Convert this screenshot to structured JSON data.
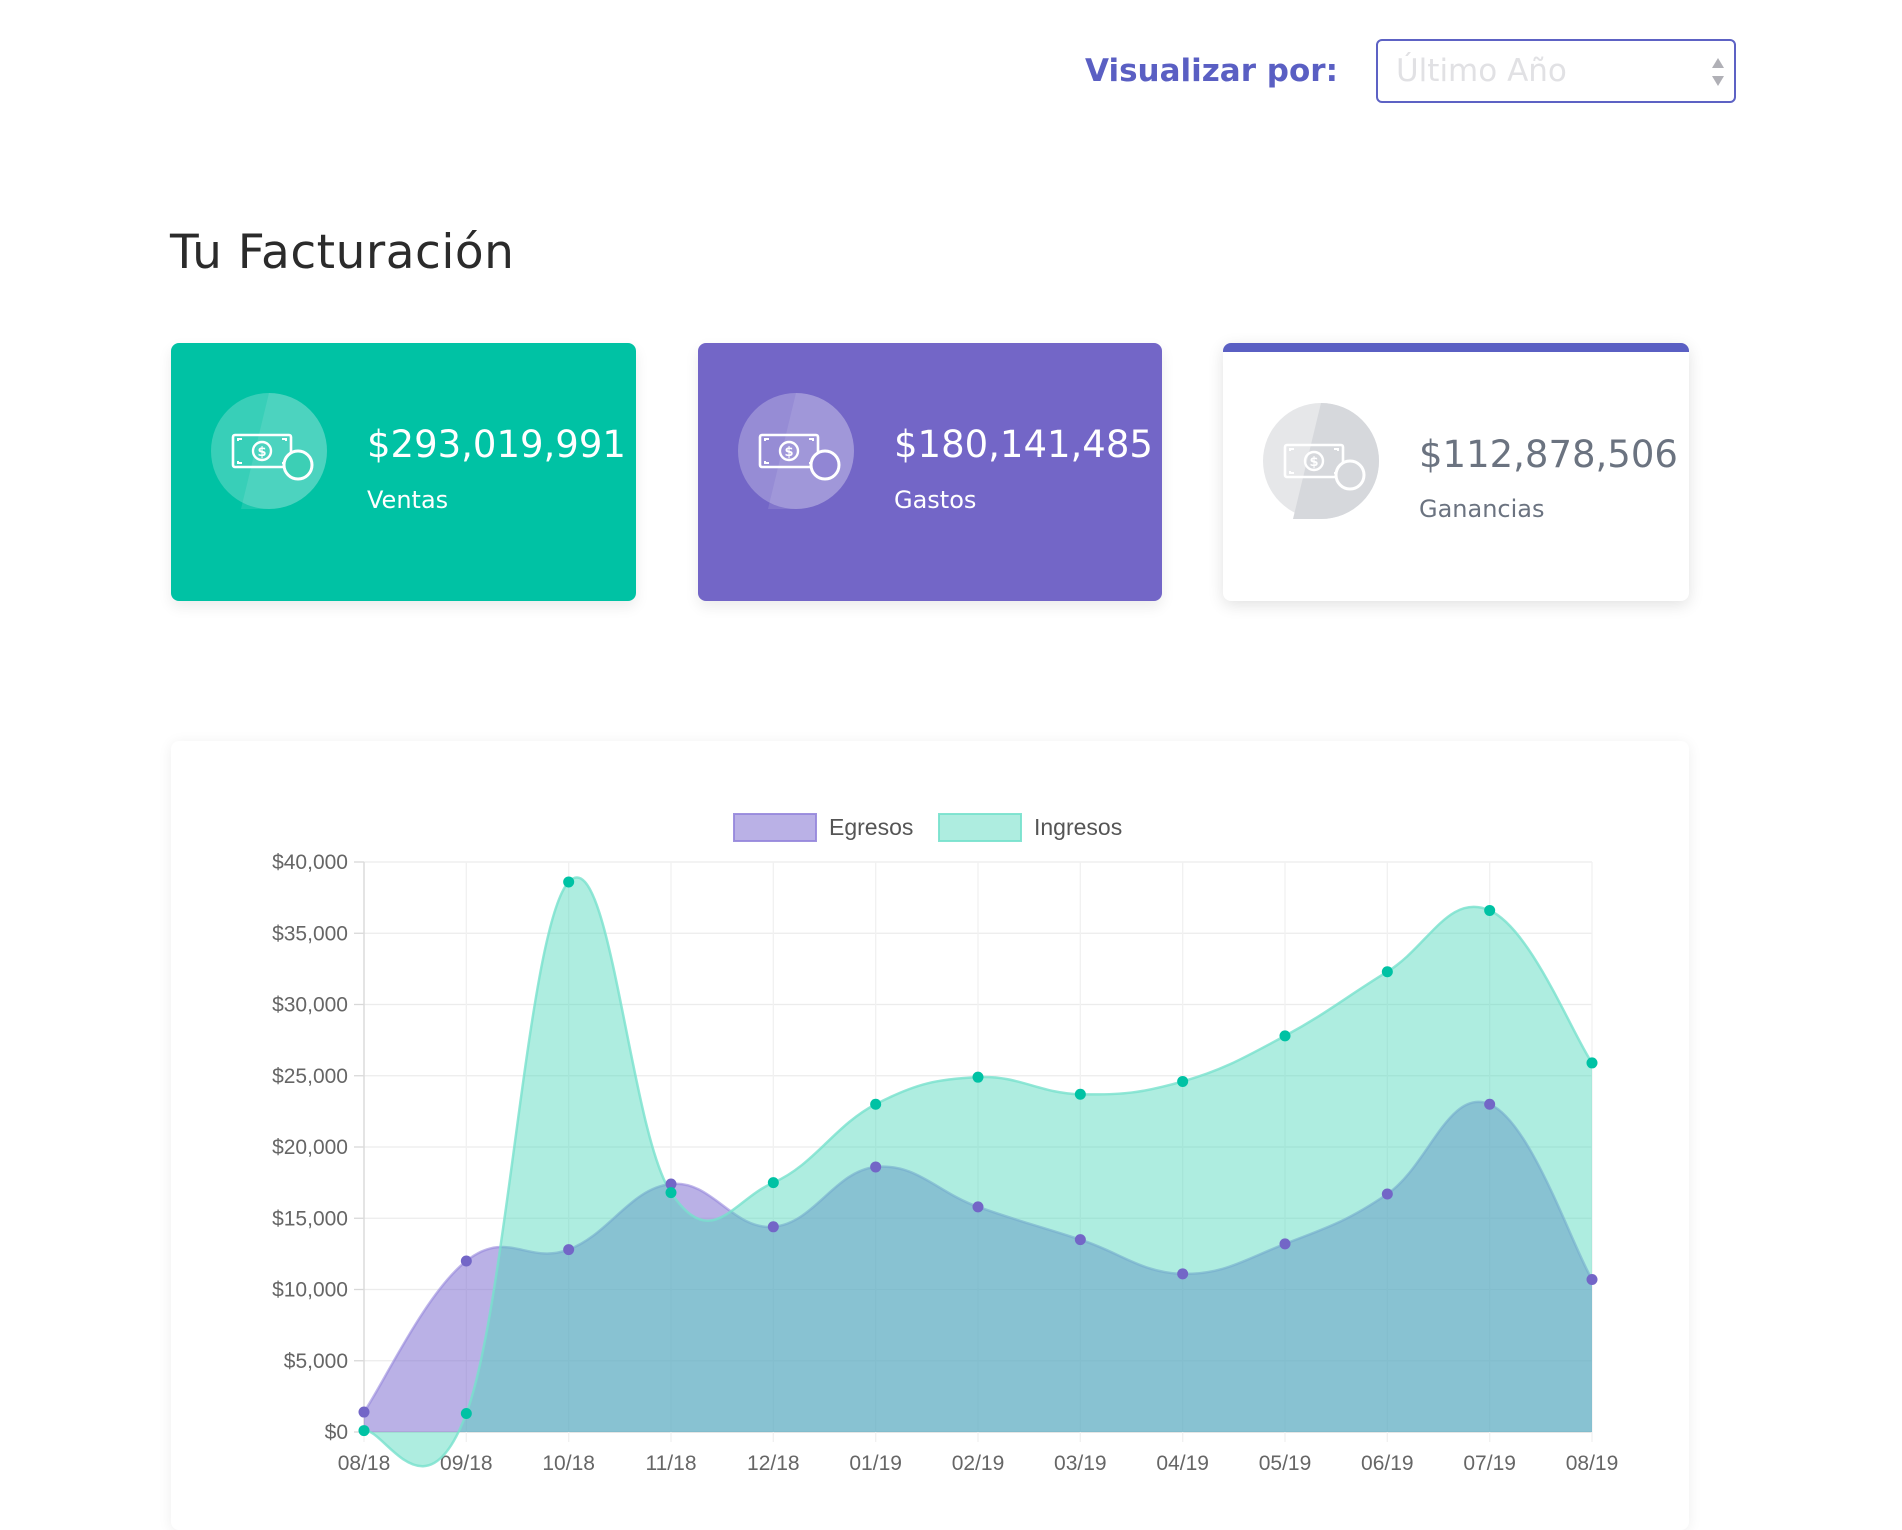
{
  "filter": {
    "label": "Visualizar por:",
    "selected": "Último Año"
  },
  "title": "Tu Facturación",
  "cards": {
    "sales": {
      "value": "$293,019,991",
      "label": "Ventas",
      "icon": "money-icon"
    },
    "expenses": {
      "value": "$180,141,485",
      "label": "Gastos",
      "icon": "money-icon"
    },
    "profit": {
      "value": "$112,878,506",
      "label": "Ganancias",
      "icon": "money-icon"
    }
  },
  "colors": {
    "accent": "#5a5fc3",
    "sales": "#00c2a4",
    "expenses": "#7366c7",
    "egresos_fill": "rgba(117,100,206,0.5)",
    "ingresos_fill": "rgba(76,215,186,0.45)",
    "egresos_point": "#7366c7",
    "ingresos_point": "#00c2a4"
  },
  "chart_data": {
    "type": "area",
    "legend_position": "top",
    "grid": true,
    "categories": [
      "08/18",
      "09/18",
      "10/18",
      "11/18",
      "12/18",
      "01/19",
      "02/19",
      "03/19",
      "04/19",
      "05/19",
      "06/19",
      "07/19",
      "08/19"
    ],
    "y_ticks": [
      "$0",
      "$5,000",
      "$10,000",
      "$15,000",
      "$20,000",
      "$25,000",
      "$30,000",
      "$35,000",
      "$40,000"
    ],
    "ylim": [
      0,
      40000
    ],
    "series": [
      {
        "name": "Egresos",
        "color": "#7366c7",
        "values": [
          1400,
          12000,
          12800,
          17400,
          14400,
          18600,
          15800,
          13500,
          11100,
          13200,
          16700,
          23000,
          10700
        ]
      },
      {
        "name": "Ingresos",
        "color": "#00c2a4",
        "values": [
          100,
          1300,
          38600,
          16800,
          17500,
          23000,
          24900,
          23700,
          24600,
          27800,
          32300,
          36600,
          25900
        ]
      }
    ]
  }
}
